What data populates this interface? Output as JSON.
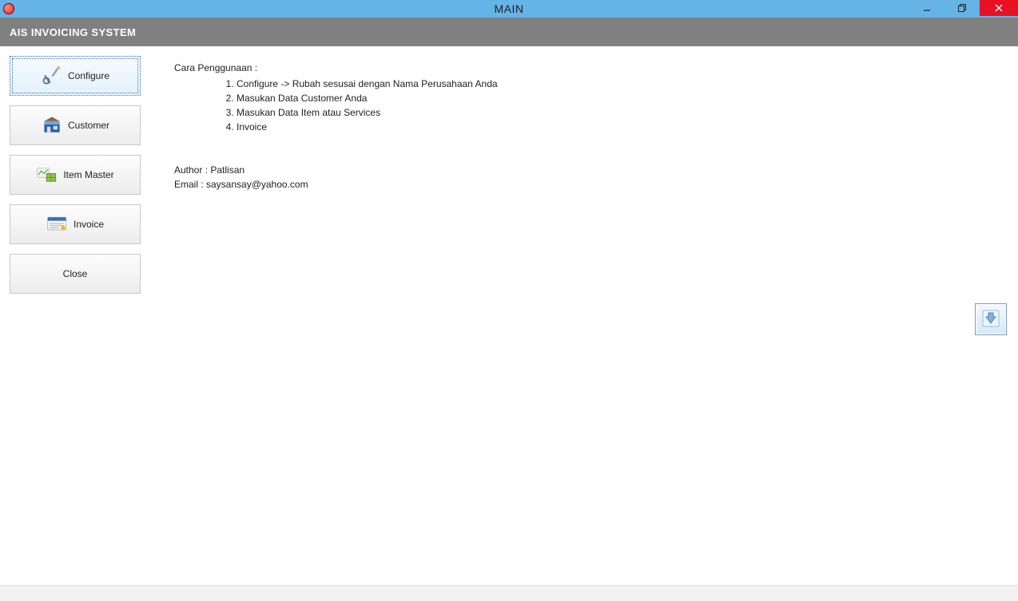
{
  "window": {
    "title": "MAIN"
  },
  "menubar": {
    "title": "AIS INVOICING SYSTEM"
  },
  "sidebar": {
    "configure_label": "Configure",
    "customer_label": "Customer",
    "itemmaster_label": "Item Master",
    "invoice_label": "Invoice",
    "close_label": "Close"
  },
  "content": {
    "usage_title": "Cara Penggunaan :",
    "steps": {
      "s1": "Configure -> Rubah sesusai dengan Nama Perusahaan Anda",
      "s2": "Masukan Data Customer Anda",
      "s3": "Masukan Data Item atau Services",
      "s4": "Invoice"
    },
    "author_line": "Author : Patlisan",
    "email_line": "Email : saysansay@yahoo.com"
  }
}
